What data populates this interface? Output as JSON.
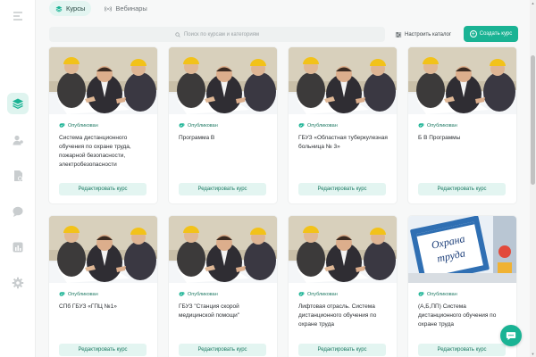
{
  "tabs": [
    {
      "label": "Курсы",
      "icon": "layers-icon",
      "active": true
    },
    {
      "label": "Вебинары",
      "icon": "broadcast-icon",
      "active": false
    }
  ],
  "search": {
    "placeholder": "Поиск по курсам и категориям"
  },
  "toolbar": {
    "catalog_label": "Настроить каталог",
    "create_label": "Создать курс"
  },
  "colors": {
    "accent": "#1ab394",
    "accent_light": "#e3f5f1",
    "status_text": "#1f7a64"
  },
  "cards": [
    {
      "status": "Опубликован",
      "title": "Система дистанционного обучения по охране труда, пожарной безопасности, электробезопасности",
      "button": "Редактировать курс",
      "image": "team-meeting-photo"
    },
    {
      "status": "Опубликован",
      "title": "Программа В",
      "button": "Редактировать курс",
      "image": "team-meeting-photo"
    },
    {
      "status": "Опубликован",
      "title": "ГБУЗ «Областная туберкулезная больница № 3»",
      "button": "Редактировать курс",
      "image": "team-meeting-photo"
    },
    {
      "status": "Опубликован",
      "title": "Б В Программы",
      "button": "Редактировать курс",
      "image": "team-meeting-photo"
    },
    {
      "status": "Опубликован",
      "title": "СПб ГБУЗ «ГПЦ №1»",
      "button": "Редактировать курс",
      "image": "team-meeting-photo"
    },
    {
      "status": "Опубликован",
      "title": "ГБУЗ \"Станция скорой медицинской помощи\"",
      "button": "Редактировать курс",
      "image": "team-meeting-photo"
    },
    {
      "status": "Опубликован",
      "title": "Лифтовая отрасль. Система дистанционного обучения по охране труда",
      "button": "Редактировать курс",
      "image": "team-meeting-photo"
    },
    {
      "status": "Опубликован",
      "title": "(А,Б,ПП) Система дистанционного обучения по охране труда",
      "button": "Редактировать курс",
      "image": "labor-safety-book-photo",
      "image_text": "Охрана труда"
    }
  ],
  "sidebar": [
    {
      "icon": "menu-icon"
    },
    {
      "icon": "layers-icon",
      "active": true
    },
    {
      "icon": "users-icon"
    },
    {
      "icon": "document-icon"
    },
    {
      "icon": "chat-icon"
    },
    {
      "icon": "chart-icon"
    },
    {
      "icon": "gear-icon"
    }
  ]
}
